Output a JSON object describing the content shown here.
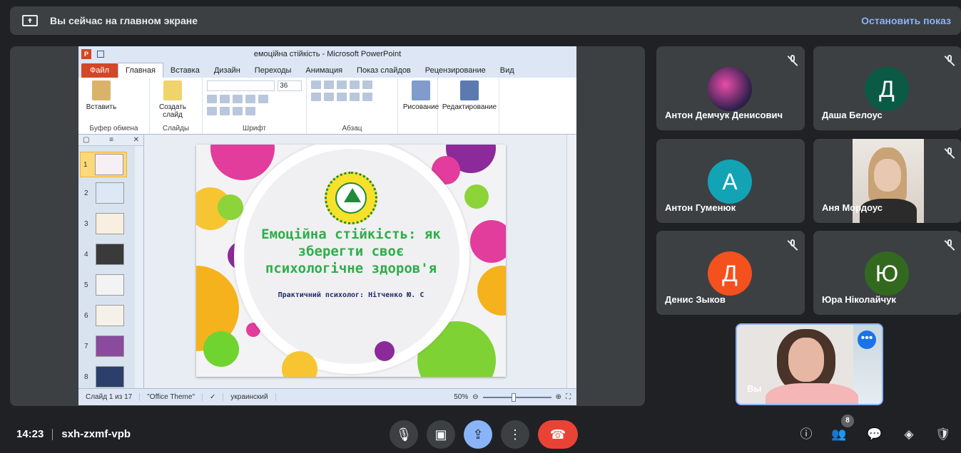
{
  "banner": {
    "title": "Вы сейчас на главном экране",
    "stop_label": "Остановить показ",
    "icon": "present-screen-icon"
  },
  "ppt": {
    "window_title": "емоційна стійкість - Microsoft PowerPoint",
    "tabs": [
      "Файл",
      "Главная",
      "Вставка",
      "Дизайн",
      "Переходы",
      "Анимация",
      "Показ слайдов",
      "Рецензирование",
      "Вид"
    ],
    "ribbon": {
      "paste": "Вставить",
      "new_slide": "Создать слайд",
      "font_size": "36",
      "drawing": "Рисование",
      "editing": "Редактирование",
      "groups": [
        "Буфер обмена",
        "Слайды",
        "Шрифт",
        "Абзац"
      ]
    },
    "thumb_numbers": [
      "1",
      "2",
      "3",
      "4",
      "5",
      "6",
      "7",
      "8"
    ],
    "slide": {
      "title": "Емоційна стійкість: як зберегти своє психологічне здоров'я",
      "subtitle": "Практичний психолог: Нітченко Ю. С"
    },
    "status": {
      "slide_count": "Слайд 1 из 17",
      "theme": "\"Office Theme\"",
      "language": "украинский",
      "zoom": "50%"
    }
  },
  "participants": [
    {
      "name": "Антон Демчук Денисович",
      "type": "photo-avatar"
    },
    {
      "name": "Даша Белоус",
      "initial": "Д",
      "color": "#0b5a45"
    },
    {
      "name": "Антон Гуменюк",
      "initial": "А",
      "color": "#12a4b5"
    },
    {
      "name": "Аня Мордоус",
      "type": "video"
    },
    {
      "name": "Денис Зыков",
      "initial": "Д",
      "color": "#f4511e"
    },
    {
      "name": "Юра Ніколайчук",
      "initial": "Ю",
      "color": "#33691e"
    }
  ],
  "self": {
    "name": "Вы"
  },
  "meeting": {
    "time": "14:23",
    "code": "sxh-zxmf-vpb",
    "participant_count": "8"
  }
}
